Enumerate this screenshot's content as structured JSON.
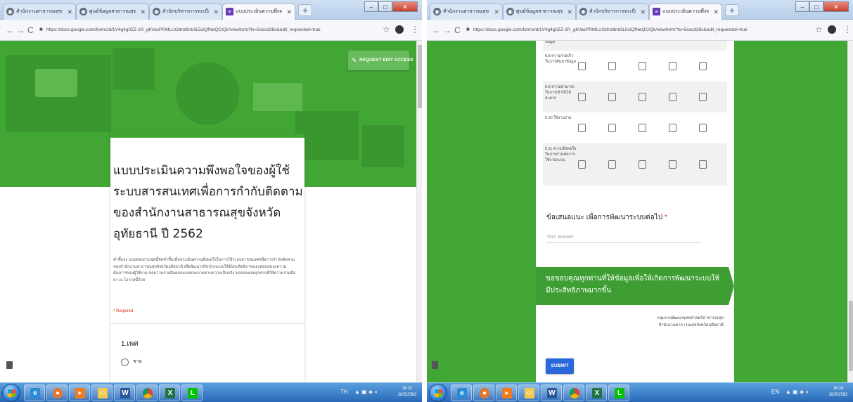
{
  "left": {
    "tabs": [
      {
        "title": "สำนักงานสาธารณสุขจังหวัดอุทัยธานี",
        "icon": "globe-icon"
      },
      {
        "title": "ศูนย์ข้อมูลสาธารณสุขจังหวัดอุทัยธานี",
        "icon": "globe-icon"
      },
      {
        "title": "สำนักบริหารการทะเบียน",
        "icon": "globe-icon"
      },
      {
        "title": "แบบประเมินความพึงพอใจของผู้ใช้ระบบ",
        "icon": "forms-icon",
        "active": true
      }
    ],
    "url": "https://docs.google.com/forms/d/1V4g4g0ZZ-1R_ghVacPRMLUOdnz8nk3L5ciQfNeQCIQk/viewform?ts=5cecd38c&edit_requested=true",
    "request_edit": "REQUEST EDIT ACCESS",
    "form_title": "แบบประเมินความพึงพอใจของผู้ใช้ระบบสารสนเทศเพื่อการกำกับติดตามของสำนักงานสาธารณสุขจังหวัดอุทัยธานี ปี 2562",
    "form_description": "คำชี้แจง แบบสอบถามชุดนี้จัดทำขึ้นเพื่อประเมินความพึงพอใจในการใช้ระบบสารสนเทศเพื่อการกำกับติดตามของสำนักงานสาธารณสุขจังหวัดอุทัยธานี เพื่อพัฒนาปรับปรุงระบบให้มีประสิทธิภาพและตอบสนองความต้องการของผู้ใช้งาน ขอความร่วมมือตอบแบบสอบถามตามความเป็นจริง ขอขอบคุณทุกท่านที่ให้ความร่วมมือมา ณ โอกาสนี้ด้วย",
    "required_note": "* Required",
    "question1": {
      "title": "1.เพศ",
      "option": "ชาย"
    },
    "clock": {
      "time": "16:22",
      "date": "28/5/2562"
    },
    "tray": "TH"
  },
  "right": {
    "tabs": [
      {
        "title": "สำนักงานสาธารณสุขจังหวัดอุทัยธานี",
        "icon": "globe-icon"
      },
      {
        "title": "ศูนย์ข้อมูลสาธารณสุขจังหวัดอุทัยธานี",
        "icon": "globe-icon"
      },
      {
        "title": "สำนักบริหารการทะเบียน",
        "icon": "globe-icon"
      },
      {
        "title": "แบบประเมินความพึงพอใจของผู้ใช้ระบบ",
        "icon": "forms-icon",
        "active": true
      }
    ],
    "url": "https://docs.google.com/forms/d/1V4g4g0ZZ-1R_ghVacPRMLUOdnz8nk3L5ciQfNeQCIQk/viewform?ts=5cecd38c&edit_requested=true",
    "grid_rows": [
      {
        "label": "ข้อมูล"
      },
      {
        "label": "6.8 ความรวดเร็วในการค้นหาข้อมูล"
      },
      {
        "label": "6.9 ความสามารถในการเข้าถึงได้สะดวก"
      },
      {
        "label": "6.10 ใช้งานง่าย"
      },
      {
        "label": "6.11 ความพึงพอใจในภาพรวมต่อการใช้งานระบบ"
      }
    ],
    "grid_columns": 5,
    "suggestion_label": "ข้อเสนอแนะ เพื่อการพัฒนาระบบต่อไป",
    "suggestion_required": "*",
    "suggestion_placeholder": "Your answer",
    "thanks_text": "ขอขอบคุณทุกท่านที่ให้ข้อมูลเพื่อให้เกิดการพัฒนาระบบให้มีประสิทธิภาพมากขึ้น",
    "org_credit": "กลุ่มงานพัฒนายุทธศาสตร์สาธารณสุข สำนักงานสาธารณสุขจังหวัดอุทัยธานี",
    "submit_label": "SUBMIT",
    "clock": {
      "time": "16:24",
      "date": "28/5/2562"
    },
    "tray": "EN"
  },
  "taskbar_apps": [
    "internet-explorer-icon",
    "firefox-icon",
    "media-player-icon",
    "folder-icon",
    "word-icon",
    "chrome-icon",
    "excel-icon",
    "line-icon"
  ],
  "colors": {
    "theme_green": "#42a635",
    "submit_blue": "#2a67d9",
    "required_red": "#d93025"
  }
}
